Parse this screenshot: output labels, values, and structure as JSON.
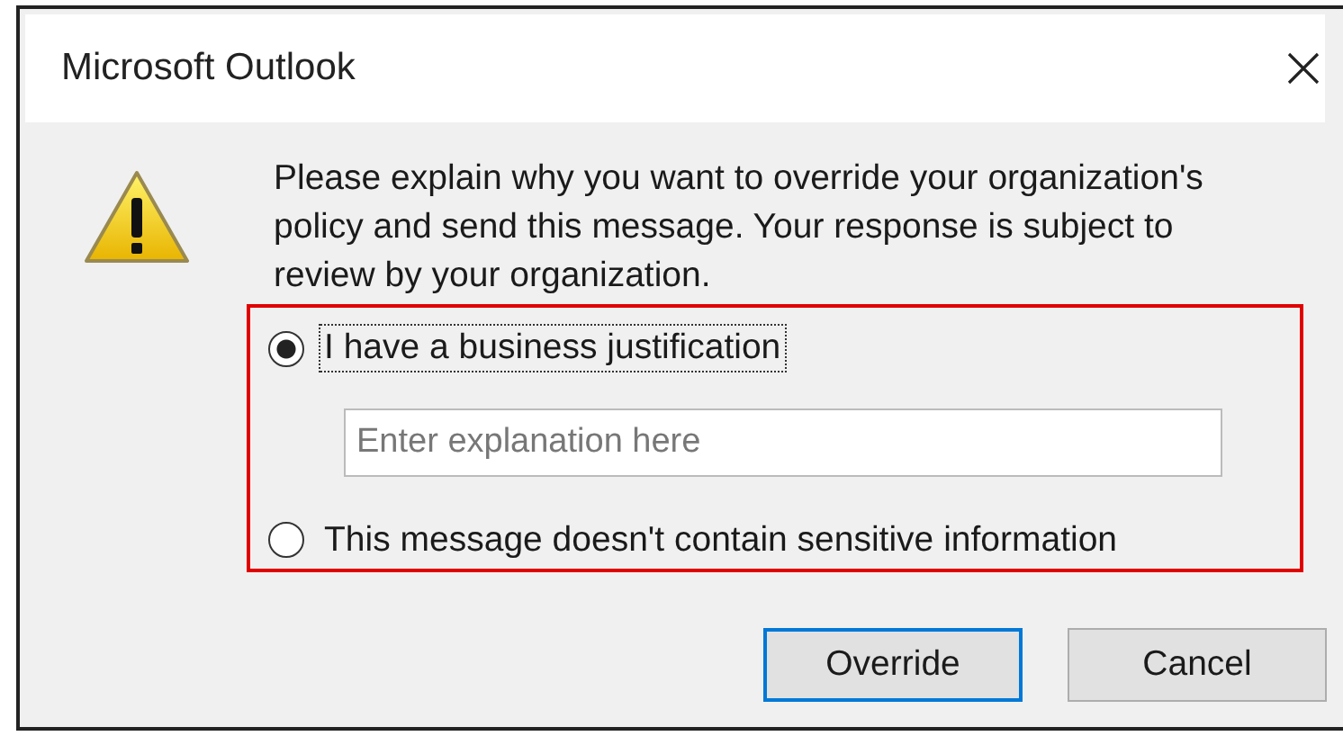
{
  "window": {
    "title": "Microsoft Outlook"
  },
  "message": "Please explain why you want to override your organization's policy and send this message. Your response is subject to review by your organization.",
  "options": [
    {
      "label": "I have a business justification",
      "selected": true,
      "focused": true
    },
    {
      "label": "This message doesn't contain sensitive information",
      "selected": false,
      "focused": false
    }
  ],
  "explanation": {
    "placeholder": "Enter explanation here"
  },
  "buttons": [
    {
      "label": "Override",
      "default": true
    },
    {
      "label": "Cancel",
      "default": false
    }
  ]
}
